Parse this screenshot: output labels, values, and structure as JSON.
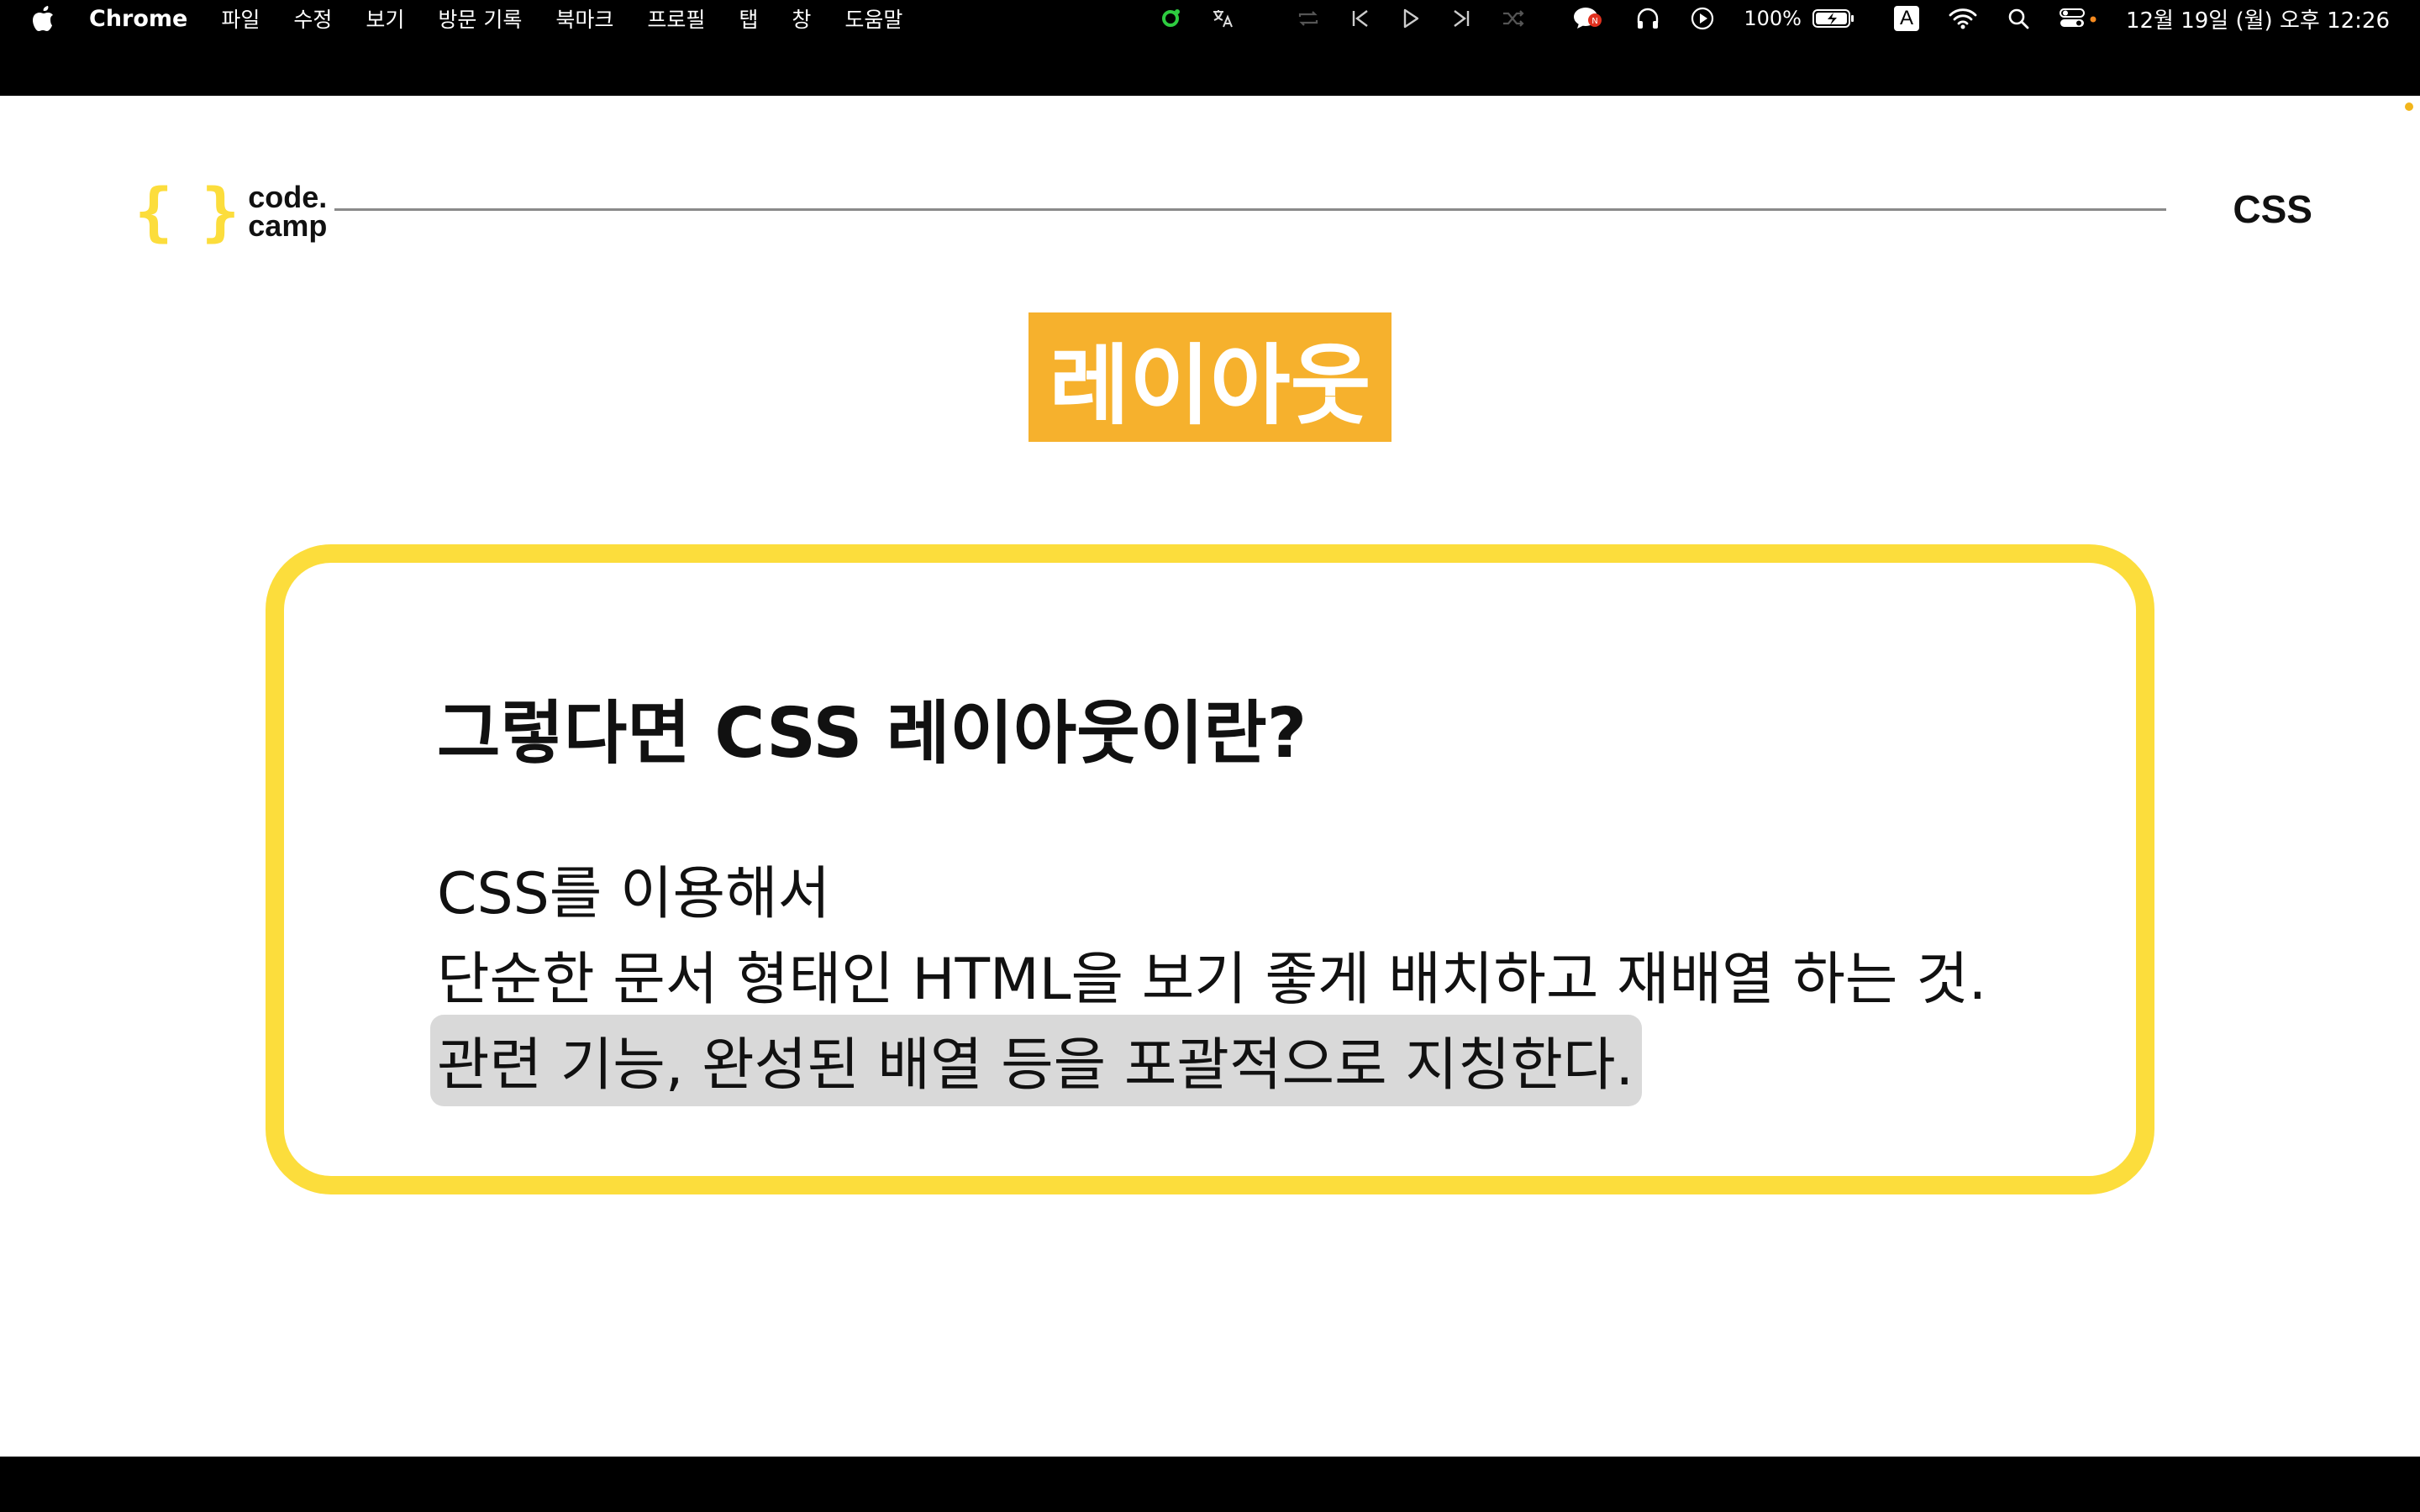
{
  "menubar": {
    "app_name": "Chrome",
    "menus": [
      "파일",
      "수정",
      "보기",
      "방문 기록",
      "북마크",
      "프로필",
      "탭",
      "창",
      "도움말"
    ],
    "battery": "100%",
    "input_method": "A",
    "datetime": "12월 19일 (월) 오후 12:26",
    "icons": [
      "apple-icon",
      "record-icon",
      "translate-icon",
      "repeat-icon",
      "previous-track-icon",
      "play-icon",
      "next-track-icon",
      "shuffle-icon",
      "chat-icon",
      "headphones-icon",
      "play-circle-icon",
      "battery-icon",
      "wifi-icon",
      "search-icon",
      "control-center-icon"
    ]
  },
  "slide": {
    "logo_top": "code.",
    "logo_bottom": "camp",
    "logo_braces": "{ }",
    "section": "CSS",
    "title": "레이아웃",
    "accent_yellow": "#fcdd3c",
    "badge_color": "#f6b12d",
    "card": {
      "heading": "그렇다면 CSS 레이아웃이란?",
      "line1": "CSS를 이용해서",
      "line2": "단순한 문서 형태인 HTML을 보기 좋게 배치하고 재배열 하는 것.",
      "line3": "관련 기능, 완성된 배열 등을 포괄적으로 지칭한다."
    }
  }
}
